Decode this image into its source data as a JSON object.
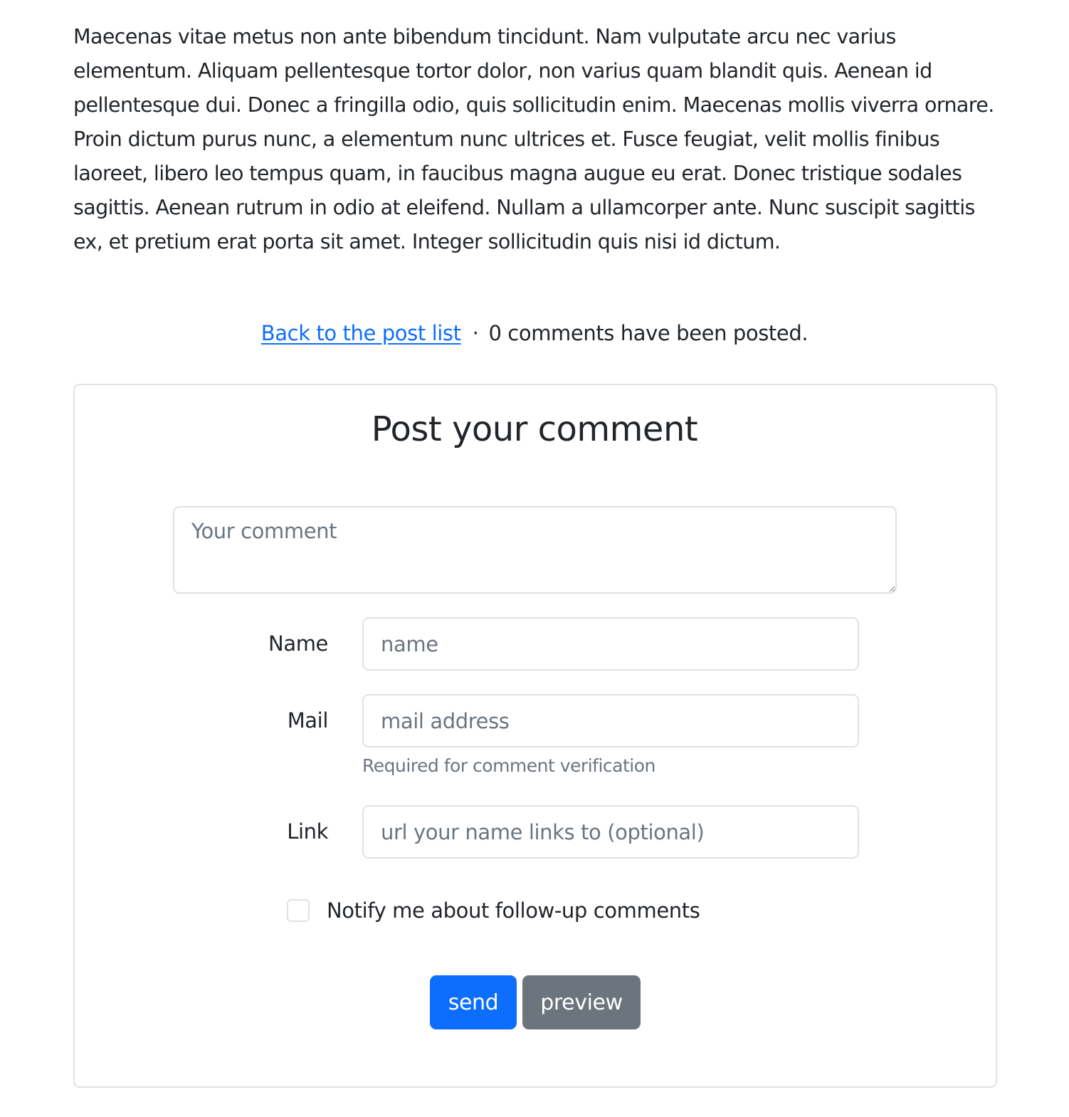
{
  "article": {
    "body": "Maecenas vitae metus non ante bibendum tincidunt. Nam vulputate arcu nec varius elementum. Aliquam pellentesque tortor dolor, non varius quam blandit quis. Aenean id pellentesque dui. Donec a fringilla odio, quis sollicitudin enim. Maecenas mollis viverra ornare. Proin dictum purus nunc, a elementum nunc ultrices et. Fusce feugiat, velit mollis finibus laoreet, libero leo tempus quam, in faucibus magna augue eu erat. Donec tristique sodales sagittis. Aenean rutrum in odio at eleifend. Nullam a ullamcorper ante. Nunc suscipit sagittis ex, et pretium erat porta sit amet. Integer sollicitudin quis nisi id dictum."
  },
  "meta": {
    "back_link": "Back to the post list",
    "separator": "·",
    "comment_count": "0 comments have been posted."
  },
  "comment_form": {
    "title": "Post your comment",
    "comment_placeholder": "Your comment",
    "name_label": "Name",
    "name_placeholder": "name",
    "mail_label": "Mail",
    "mail_placeholder": "mail address",
    "mail_help": "Required for comment verification",
    "link_label": "Link",
    "link_placeholder": "url your name links to (optional)",
    "notify_label": "Notify me about follow-up comments",
    "send_label": "send",
    "preview_label": "preview"
  },
  "colors": {
    "primary": "#0d6efd",
    "secondary": "#6c757d",
    "border": "#dee2e6"
  }
}
